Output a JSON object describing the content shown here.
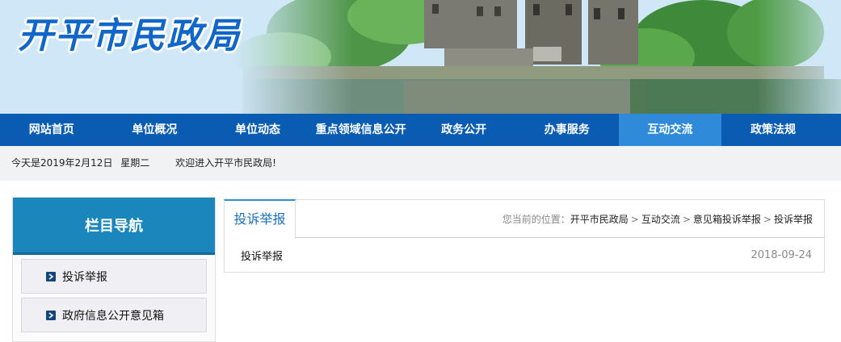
{
  "header": {
    "site_title": "开平市民政局"
  },
  "nav": {
    "items": [
      {
        "label": "网站首页"
      },
      {
        "label": "单位概况"
      },
      {
        "label": "单位动态"
      },
      {
        "label": "重点领域信息公开"
      },
      {
        "label": "政务公开"
      },
      {
        "label": "办事服务"
      },
      {
        "label": "互动交流",
        "active": true
      },
      {
        "label": "政策法规"
      }
    ]
  },
  "datebar": {
    "date": "今天是2019年2月12日",
    "weekday": "星期二",
    "welcome": "欢迎进入开平市民政局!"
  },
  "sidebar": {
    "title": "栏目导航",
    "items": [
      {
        "label": "投诉举报"
      },
      {
        "label": "政府信息公开意见箱"
      }
    ]
  },
  "content": {
    "tab": "投诉举报",
    "breadcrumb": {
      "prefix": "您当前的位置：",
      "items": [
        "开平市民政局",
        "互动交流",
        "意见箱投诉举报",
        "投诉举报"
      ],
      "separator": ">"
    },
    "list": [
      {
        "title": "投诉举报",
        "date": "2018-09-24"
      }
    ]
  },
  "colors": {
    "nav_bg": "#0a5cb2",
    "nav_active": "#2f8ad9",
    "sidebar_header": "#1a86bb",
    "title_blue": "#1167c9"
  }
}
